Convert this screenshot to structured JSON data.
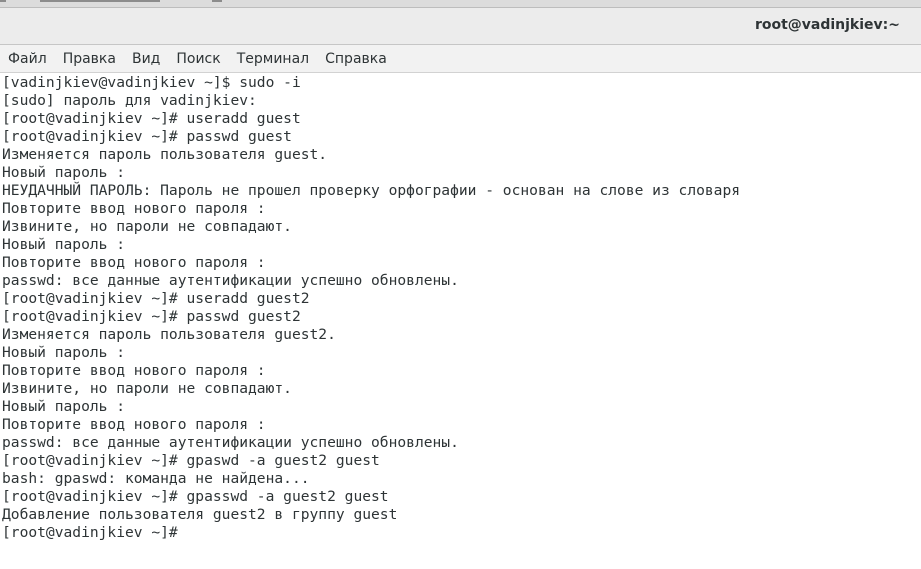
{
  "window": {
    "title": "root@vadinjkiev:~"
  },
  "menu": {
    "items": [
      "Файл",
      "Правка",
      "Вид",
      "Поиск",
      "Терминал",
      "Справка"
    ]
  },
  "terminal": {
    "lines": [
      "[vadinjkiev@vadinjkiev ~]$ sudo -i",
      "[sudo] пароль для vadinjkiev:",
      "[root@vadinjkiev ~]# useradd guest",
      "[root@vadinjkiev ~]# passwd guest",
      "Изменяется пароль пользователя guest.",
      "Новый пароль :",
      "НЕУДАЧНЫЙ ПАРОЛЬ: Пароль не прошел проверку орфографии - основан на слове из словаря",
      "Повторите ввод нового пароля :",
      "Извините, но пароли не совпадают.",
      "Новый пароль :",
      "Повторите ввод нового пароля :",
      "passwd: все данные аутентификации успешно обновлены.",
      "[root@vadinjkiev ~]# useradd guest2",
      "[root@vadinjkiev ~]# passwd guest2",
      "Изменяется пароль пользователя guest2.",
      "Новый пароль :",
      "Повторите ввод нового пароля :",
      "Извините, но пароли не совпадают.",
      "Новый пароль :",
      "Повторите ввод нового пароля :",
      "passwd: все данные аутентификации успешно обновлены.",
      "[root@vadinjkiev ~]# gpaswd -a guest2 guest",
      "bash: gpaswd: команда не найдена...",
      "[root@vadinjkiev ~]# gpasswd -a guest2 guest",
      "Добавление пользователя guest2 в группу guest",
      "[root@vadinjkiev ~]#"
    ]
  }
}
